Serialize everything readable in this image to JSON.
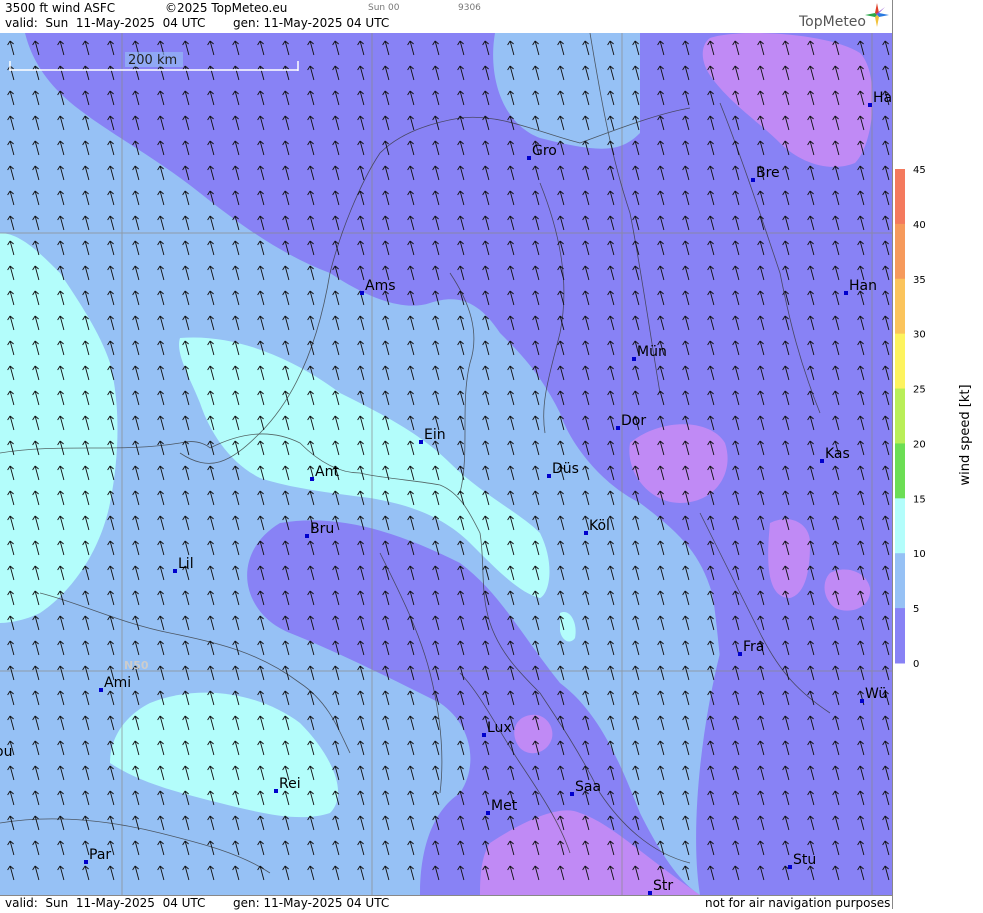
{
  "header": {
    "title": "3500 ft wind ASFC",
    "copyright": "©2025 TopMeteo.eu",
    "valid": "valid:  Sun  11-May-2025  04 UTC",
    "gen": "gen: 11-May-2025 04 UTC",
    "small_day": "Sun 00",
    "small_code": "9306",
    "logo": "TopMeteo"
  },
  "footer": {
    "valid": "valid:  Sun  11-May-2025  04 UTC",
    "gen": "gen: 11-May-2025 04 UTC",
    "notice": "not for air navigation purposes"
  },
  "map": {
    "scale_label": "200 km",
    "lat_label": "N50",
    "cities": [
      "Ha",
      "Gro",
      "Bre",
      "Ams",
      "Han",
      "Mün",
      "Dor",
      "Ein",
      "Kas",
      "Ant",
      "Düs",
      "Bru",
      "Köl",
      "Lil",
      "Fra",
      "Ami",
      "Wü",
      "Lux",
      "ou",
      "Rei",
      "Saa",
      "Met",
      "Par",
      "Stu",
      "Str"
    ]
  },
  "legend": {
    "label": "wind speed [kt]",
    "ticks": [
      "45",
      "40",
      "35",
      "30",
      "25",
      "20",
      "15",
      "10",
      "5",
      "0"
    ],
    "colors": [
      "#f47a5e",
      "#f69a5c",
      "#fbc45c",
      "#fdf35f",
      "#b9ee58",
      "#6cde55",
      "#b3fdfb",
      "#96c1f5",
      "#8882f5",
      "#c08af5"
    ]
  },
  "colors": {
    "band_0_5": "#c08af5",
    "band_5_10": "#8882f5",
    "band_10_15": "#96c1f5",
    "band_15_20": "#b3fdfb"
  }
}
